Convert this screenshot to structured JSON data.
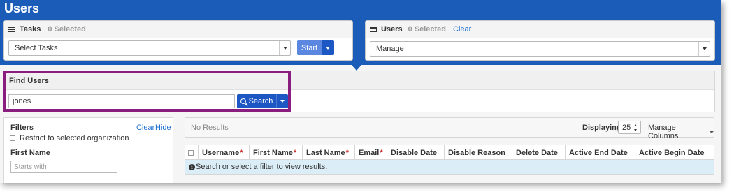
{
  "page": {
    "title": "Users"
  },
  "tasks_panel": {
    "title": "Tasks",
    "selected_count": "0 Selected",
    "select_value": "Select Tasks",
    "start_label": "Start"
  },
  "users_panel": {
    "title": "Users",
    "selected_count": "0 Selected",
    "clear_label": "Clear",
    "select_value": "Manage"
  },
  "find_users": {
    "title": "Find Users",
    "query": "jones",
    "search_label": "Search"
  },
  "filters": {
    "title": "Filters",
    "clear_label": "Clear",
    "hide_label": "Hide",
    "restrict_label": "Restrict to selected organization",
    "first_name_label": "First Name",
    "first_name_placeholder": "Starts with"
  },
  "results_bar": {
    "status": "No Results",
    "displaying_label": "Displaying",
    "page_size": "25",
    "manage_columns_label": "Manage Columns"
  },
  "table": {
    "columns": [
      {
        "label": "Username",
        "required": "*"
      },
      {
        "label": "First Name",
        "required": "*"
      },
      {
        "label": "Last Name",
        "required": "*"
      },
      {
        "label": "Email",
        "required": "*"
      },
      {
        "label": "Disable Date",
        "required": ""
      },
      {
        "label": "Disable Reason",
        "required": ""
      },
      {
        "label": "Delete Date",
        "required": ""
      },
      {
        "label": "Active End Date",
        "required": ""
      },
      {
        "label": "Active Begin Date",
        "required": ""
      }
    ],
    "info_icon_text": "i",
    "info_message": "Search or select a filter to view results."
  },
  "colors": {
    "banner": "#1b5cb8",
    "primary_button": "#1c57c3",
    "highlight_border": "#8a1e7e",
    "info_row": "#dbeef7",
    "required_marker": "#c9302c"
  },
  "icons": [
    "list-icon",
    "card-icon",
    "search-icon",
    "info-icon",
    "chevron-down-icon"
  ]
}
